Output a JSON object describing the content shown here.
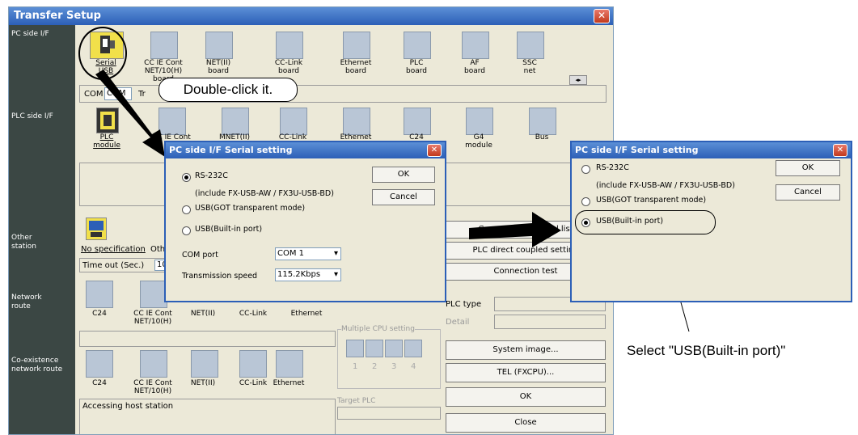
{
  "window": {
    "title": "Transfer Setup",
    "sections": {
      "pc_side": "PC side I/F",
      "plc_side": "PLC side I/F",
      "other_station": "Other\nstation",
      "network_route": "Network\nroute",
      "coexistence": "Co-existence\nnetwork route"
    },
    "pc_icons": [
      {
        "label": "Serial\nUSB",
        "icon": "serial-usb-icon"
      },
      {
        "label": "CC IE Cont\nNET/10(H)\nboard",
        "icon": "board-icon"
      },
      {
        "label": "NET(II)\nboard",
        "icon": "board-icon"
      },
      {
        "label": "CC-Link\nboard",
        "icon": "board-icon"
      },
      {
        "label": "Ethernet\nboard",
        "icon": "board-icon"
      },
      {
        "label": "PLC\nboard",
        "icon": "board-icon"
      },
      {
        "label": "AF\nboard",
        "icon": "board-icon"
      },
      {
        "label": "SSC\nnet",
        "icon": "board-icon"
      }
    ],
    "com_row": {
      "label": "COM",
      "value": "COM",
      "trailing": "Tr"
    },
    "plc_icons": [
      {
        "label": "PLC\nmodule"
      },
      {
        "label": "CC IE Cont\nNET\nm"
      },
      {
        "label": "MNET(II)"
      },
      {
        "label": "CC-Link"
      },
      {
        "label": "Ethernet"
      },
      {
        "label": "C24"
      },
      {
        "label": "G4\nmodule"
      },
      {
        "label": "Bus"
      }
    ],
    "other": {
      "no_spec": "No specification",
      "oth": "Oth",
      "timeout_label": "Time out (Sec.)",
      "timeout_value": "10"
    },
    "network_icons": [
      "C24",
      "CC IE Cont\nNET/10(H)",
      "NET(II)",
      "CC-Link",
      "Ethernet"
    ],
    "coexist_icons": [
      "C24",
      "CC IE Cont\nNET/10(H)",
      "NET(II)",
      "CC-Link",
      "Ethernet"
    ],
    "right_buttons": {
      "connection_channel": "Connection channel list",
      "plc_direct": "PLC direct coupled setting",
      "connection_test": "Connection test",
      "system_image": "System   image...",
      "tel": "TEL (FXCPU)...",
      "ok": "OK",
      "close": "Close"
    },
    "plc_type_label": "PLC type",
    "detail_label": "Detail",
    "multiple_cpu": {
      "label": "Multiple CPU setting",
      "nums": [
        "1",
        "2",
        "3",
        "4"
      ]
    },
    "target_plc": "Target PLC",
    "accessing": "Accessing host station"
  },
  "dialog1": {
    "title": "PC side I/F  Serial setting",
    "options": [
      {
        "label": "RS-232C",
        "selected": true
      },
      {
        "label": "USB(GOT transparent mode)",
        "selected": false
      },
      {
        "label": "USB(Built-in port)",
        "selected": false
      }
    ],
    "note": "(include FX-USB-AW / FX3U-USB-BD)",
    "ok": "OK",
    "cancel": "Cancel",
    "com_port_label": "COM port",
    "com_port_value": "COM 1",
    "speed_label": "Transmission speed",
    "speed_value": "115.2Kbps"
  },
  "dialog2": {
    "title": "PC side I/F  Serial setting",
    "options": [
      {
        "label": "RS-232C",
        "selected": false
      },
      {
        "label": "USB(GOT transparent mode)",
        "selected": false
      },
      {
        "label": "USB(Built-in port)",
        "selected": true
      }
    ],
    "note": "(include FX-USB-AW / FX3U-USB-BD)",
    "ok": "OK",
    "cancel": "Cancel"
  },
  "annotations": {
    "callout": "Double-click it.",
    "select_note": "Select \"USB(Built-in port)\""
  },
  "colors": {
    "titlebar": "#2c5fb7",
    "dialog_bg": "#ece9d8",
    "left_panel": "#3b4744",
    "icon_box": "#b9c6d6"
  }
}
